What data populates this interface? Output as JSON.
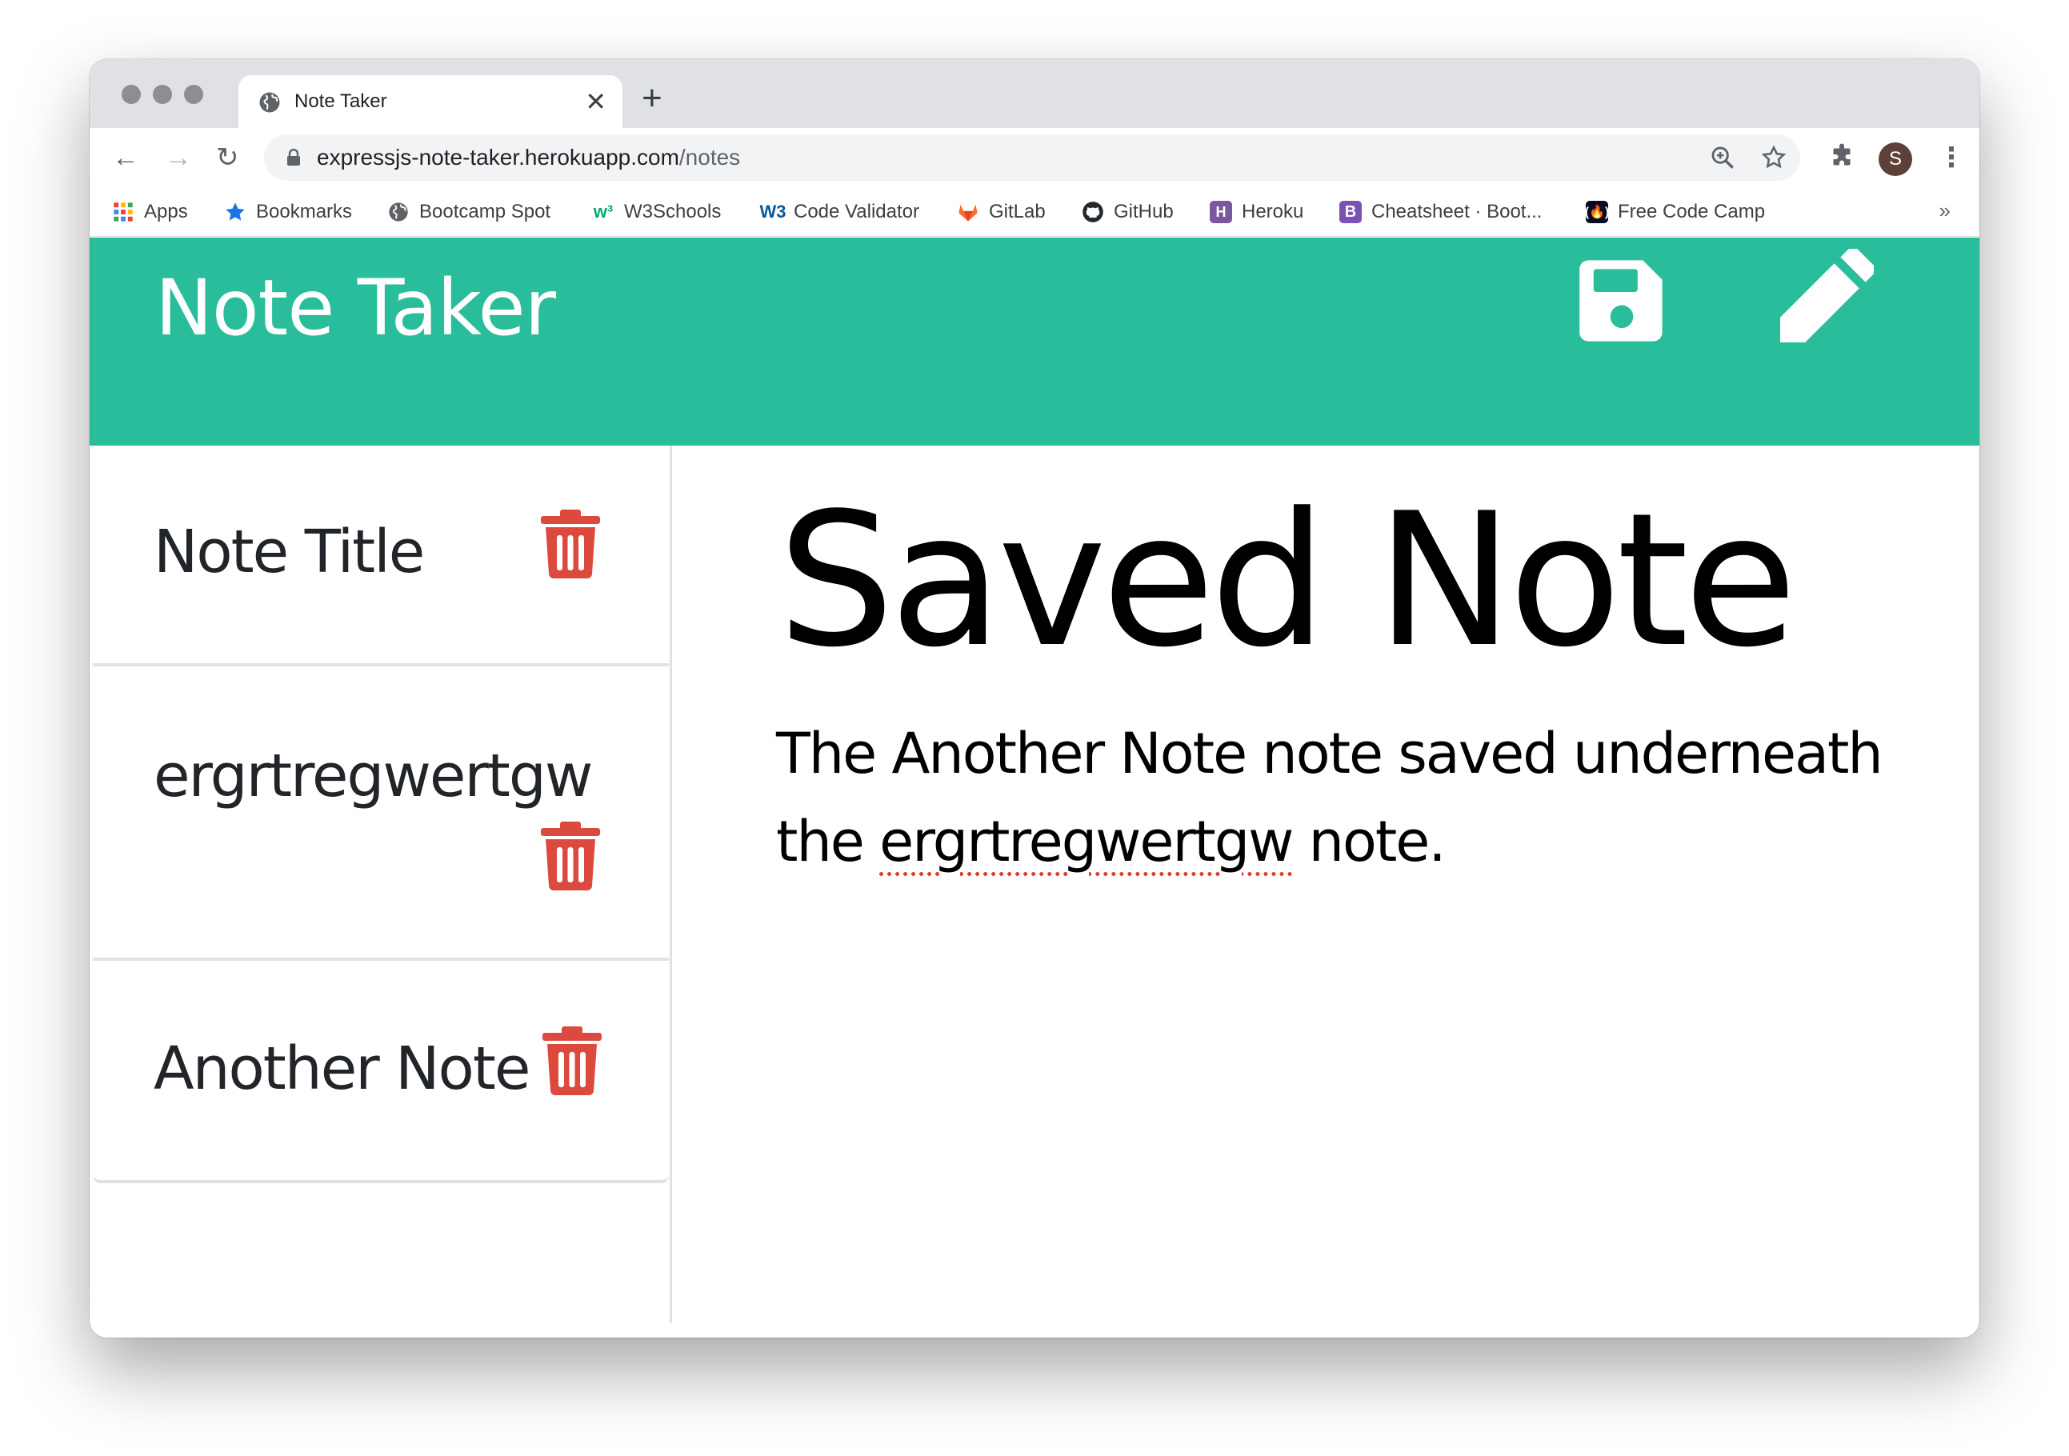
{
  "browser": {
    "tab_title": "Note Taker",
    "tab_close": "✕",
    "new_tab": "+",
    "url_host": "expressjs-note-taker.herokuapp.com",
    "url_path": "/notes",
    "avatar_letter": "S",
    "bookmarks": [
      {
        "label": "Apps",
        "icon": "apps-grid-icon"
      },
      {
        "label": "Bookmarks",
        "icon": "star-icon"
      },
      {
        "label": "Bootcamp Spot",
        "icon": "globe-icon"
      },
      {
        "label": "W3Schools",
        "icon": "w3schools-icon"
      },
      {
        "label": "Code Validator",
        "icon": "w3c-icon"
      },
      {
        "label": "GitLab",
        "icon": "gitlab-icon"
      },
      {
        "label": "GitHub",
        "icon": "github-icon"
      },
      {
        "label": "Heroku",
        "icon": "heroku-icon"
      },
      {
        "label": "Cheatsheet · Boot...",
        "icon": "bootstrap-icon"
      },
      {
        "label": "Free Code Camp",
        "icon": "freecodecamp-icon"
      }
    ],
    "bookmarks_more": "»"
  },
  "app": {
    "brand": "Note Taker",
    "accent_color": "#2abd9b",
    "trash_color": "#dc4a3d",
    "notes": [
      {
        "title": "Note Title"
      },
      {
        "title": "ergrtregwertgw"
      },
      {
        "title": "Another Note"
      }
    ],
    "active_note": {
      "title": "Saved Note",
      "text_part1": "The Another Note note saved underneath the ",
      "text_misspelled": "ergrtregwertgw",
      "text_part2": " note."
    }
  }
}
